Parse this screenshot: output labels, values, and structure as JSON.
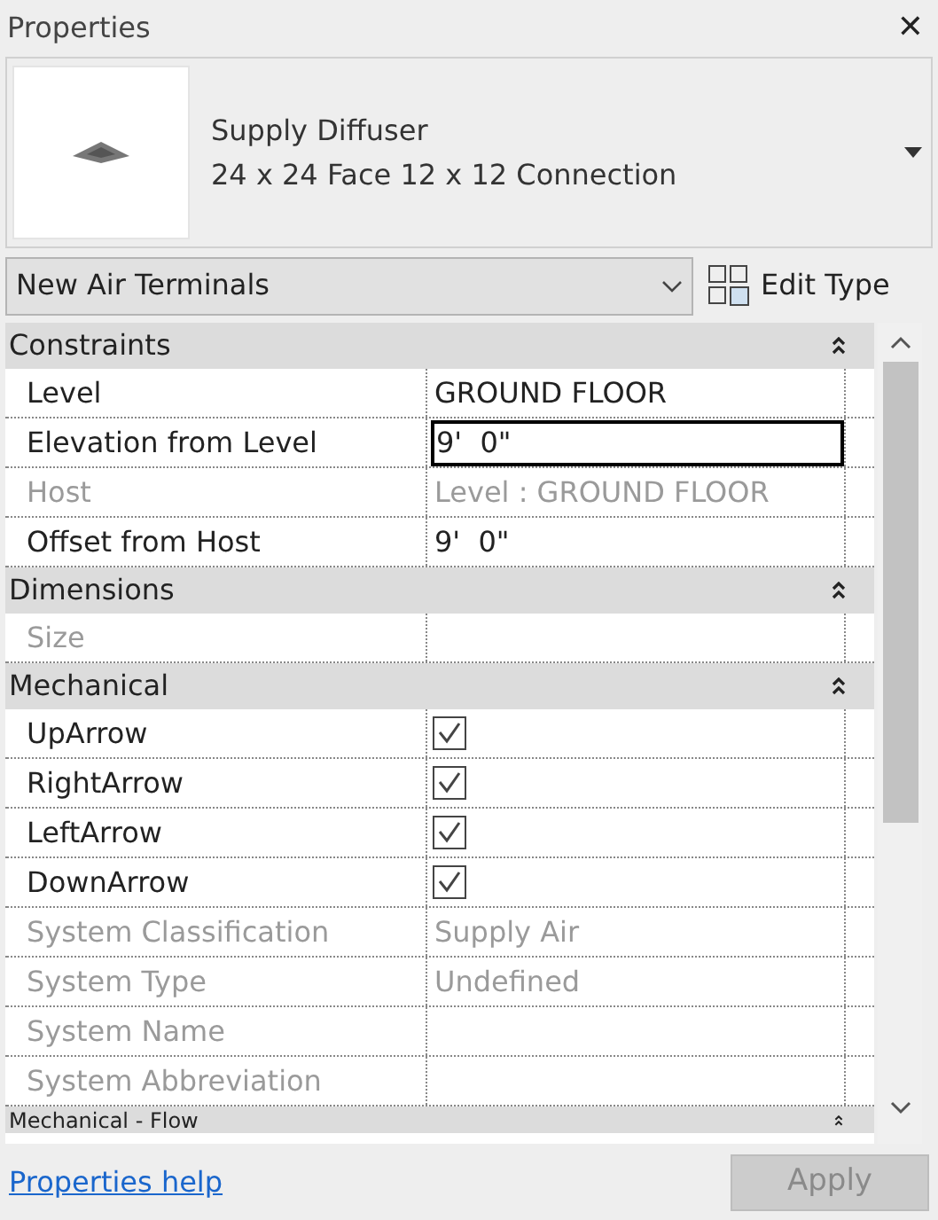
{
  "window": {
    "title": "Properties",
    "close": "✕"
  },
  "type_selector": {
    "family": "Supply Diffuser",
    "type": "24 x 24 Face 12 x 12 Connection"
  },
  "filter": {
    "value": "New Air Terminals",
    "edit_type": "Edit Type"
  },
  "groups": [
    {
      "title": "Constraints",
      "expanded": true,
      "rows": [
        {
          "kind": "text",
          "name": "Level",
          "value": "GROUND FLOOR",
          "disabled": false
        },
        {
          "kind": "text",
          "name": "Elevation from Level",
          "value": "9'  0\"",
          "disabled": false,
          "editing": true
        },
        {
          "kind": "text",
          "name": "Host",
          "value": "Level : GROUND FLOOR",
          "disabled": true
        },
        {
          "kind": "text",
          "name": "Offset from Host",
          "value": "9'  0\"",
          "disabled": false
        }
      ]
    },
    {
      "title": "Dimensions",
      "expanded": true,
      "rows": [
        {
          "kind": "text",
          "name": "Size",
          "disabled": true
        }
      ]
    },
    {
      "title": "Mechanical",
      "expanded": true,
      "rows": [
        {
          "kind": "checkbox",
          "name": "UpArrow",
          "checked": true,
          "disabled": false
        },
        {
          "kind": "checkbox",
          "name": "RightArrow",
          "checked": true,
          "disabled": false
        },
        {
          "kind": "checkbox",
          "name": "LeftArrow",
          "checked": true,
          "disabled": false
        },
        {
          "kind": "checkbox",
          "name": "DownArrow",
          "checked": true,
          "disabled": false
        },
        {
          "kind": "text",
          "name": "System Classification",
          "value": "Supply Air",
          "disabled": true
        },
        {
          "kind": "text",
          "name": "System Type",
          "value": "Undefined",
          "disabled": true
        },
        {
          "kind": "text",
          "name": "System Name",
          "disabled": true
        },
        {
          "kind": "text",
          "name": "System Abbreviation",
          "disabled": true
        }
      ]
    },
    {
      "title": "Mechanical - Flow",
      "expanded": true
    }
  ],
  "footer": {
    "help_link": "Properties help",
    "apply": "Apply",
    "apply_disabled": true
  }
}
